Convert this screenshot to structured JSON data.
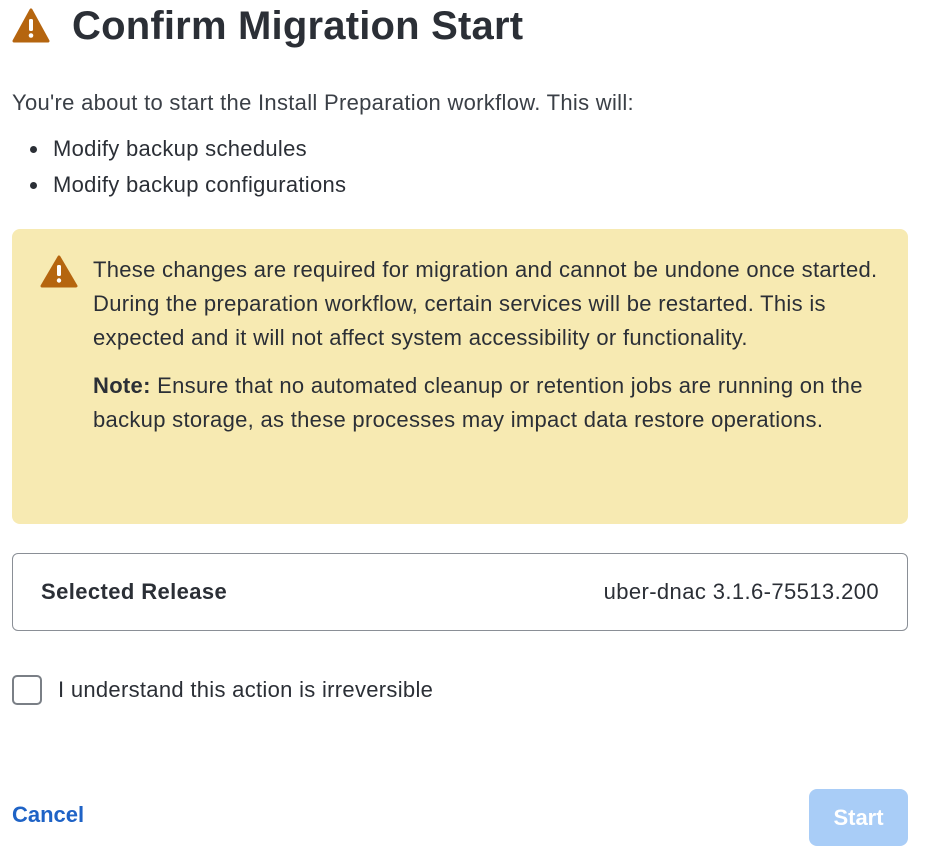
{
  "dialog": {
    "title": "Confirm Migration Start",
    "title_icon": "warning-triangle-icon",
    "intro": "You're about to start the Install Preparation workflow. This will:",
    "bullets": [
      "Modify backup schedules",
      "Modify backup configurations"
    ],
    "warning": {
      "icon": "warning-triangle-icon",
      "message": "These changes are required for migration and cannot be undone once started. During the preparation workflow, certain services will be restarted. This is expected and it will not affect system accessibility or functionality.",
      "note_label": "Note:",
      "note_text": "Ensure that no automated cleanup or retention jobs are running on the backup storage, as these processes may impact data restore operations."
    },
    "release": {
      "label": "Selected Release",
      "value": "uber-dnac 3.1.6-75513.200"
    },
    "acknowledge": {
      "label": "I understand this action is irreversible",
      "checked": false
    },
    "actions": {
      "cancel_label": "Cancel",
      "start_label": "Start",
      "start_enabled": false
    }
  },
  "colors": {
    "warning_icon": "#b5650f",
    "warning_bg": "#f7eab2",
    "link": "#1f63c6",
    "start_disabled_bg": "#a9cdf7",
    "text": "#2b2f36",
    "border": "#8a8f96"
  }
}
